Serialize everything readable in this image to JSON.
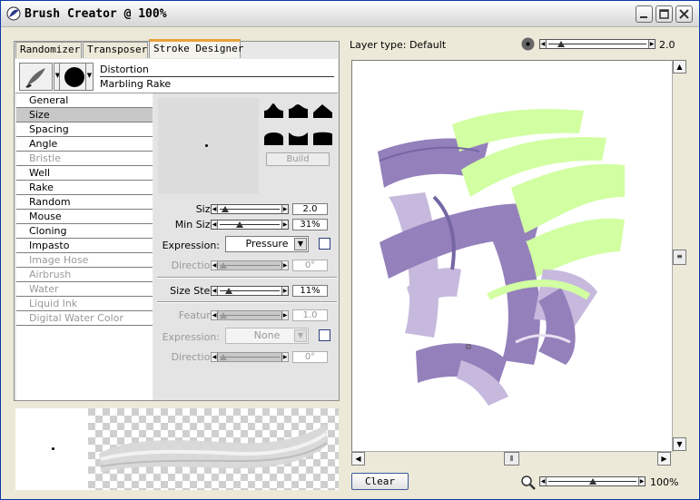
{
  "window": {
    "title": "Brush Creator @ 100%",
    "controls": [
      "minimize",
      "maximize",
      "close"
    ]
  },
  "tabs": [
    {
      "label": "Randomizer",
      "active": false
    },
    {
      "label": "Transposer",
      "active": false
    },
    {
      "label": "Stroke Designer",
      "active": true
    }
  ],
  "brush": {
    "category": "Distortion",
    "variant": "Marbling Rake"
  },
  "categories": [
    {
      "label": "General",
      "state": "enabled"
    },
    {
      "label": "Size",
      "state": "selected"
    },
    {
      "label": "Spacing",
      "state": "enabled"
    },
    {
      "label": "Angle",
      "state": "enabled"
    },
    {
      "label": "Bristle",
      "state": "disabled"
    },
    {
      "label": "Well",
      "state": "enabled"
    },
    {
      "label": "Rake",
      "state": "enabled"
    },
    {
      "label": "Random",
      "state": "enabled"
    },
    {
      "label": "Mouse",
      "state": "enabled"
    },
    {
      "label": "Cloning",
      "state": "enabled"
    },
    {
      "label": "Impasto",
      "state": "enabled"
    },
    {
      "label": "Image Hose",
      "state": "disabled"
    },
    {
      "label": "Airbrush",
      "state": "disabled"
    },
    {
      "label": "Water",
      "state": "disabled"
    },
    {
      "label": "Liquid Ink",
      "state": "disabled"
    },
    {
      "label": "Digital Water Color",
      "state": "disabled"
    }
  ],
  "size_panel": {
    "build_label": "Build",
    "size": {
      "label": "Size:",
      "value": "2.0",
      "fraction": 0.04
    },
    "min_size": {
      "label": "Min Size:",
      "value": "31%",
      "fraction": 0.31
    },
    "expression": {
      "label": "Expression:",
      "value": "Pressure"
    },
    "direction": {
      "label": "Direction:",
      "value": "0°",
      "fraction": 0.0
    },
    "size_step": {
      "label": "Size Step:",
      "value": "11%",
      "fraction": 0.11
    },
    "feature": {
      "label": "Feature:",
      "value": "1.0",
      "fraction": 0.0
    },
    "expression2": {
      "label": "Expression:",
      "value": "None"
    },
    "direction2": {
      "label": "Direction:",
      "value": "0°",
      "fraction": 0.0
    }
  },
  "canvas": {
    "layer_type": "Layer type: Default",
    "brush_size_value": "2.0",
    "brush_size_fraction": 0.1,
    "zoom_value": "100%",
    "zoom_fraction": 0.5,
    "clear_label": "Clear",
    "colors": {
      "purple": "#8f7ab8",
      "lavender": "#c3b6dc",
      "lime": "#cfff9c"
    }
  }
}
